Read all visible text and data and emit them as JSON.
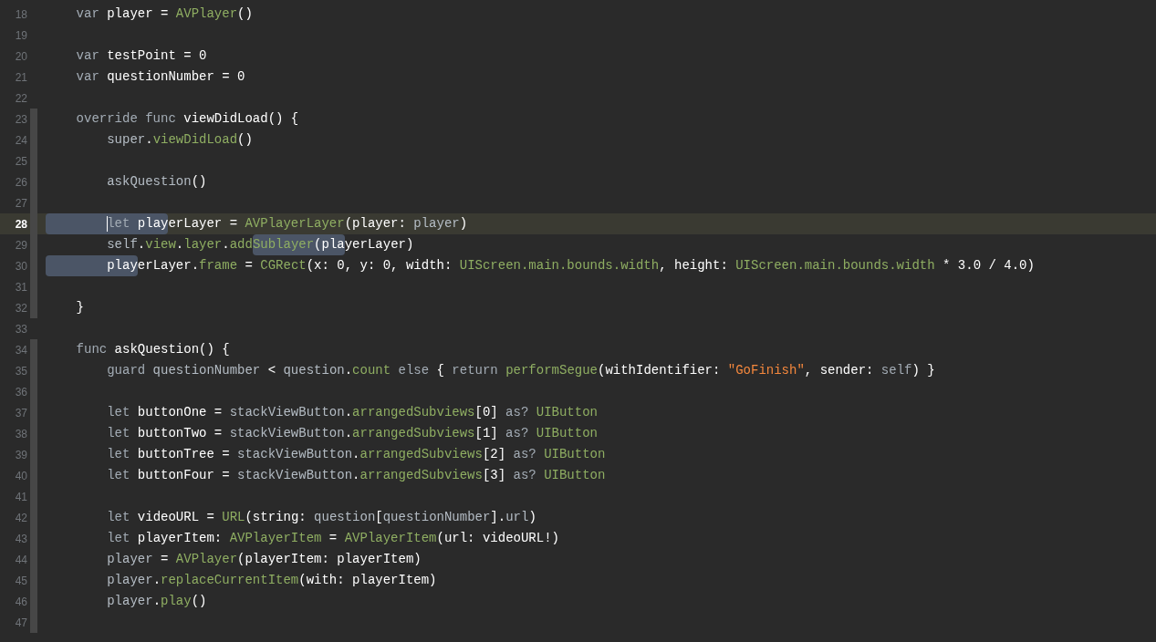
{
  "editor": {
    "lines": [
      {
        "number": "18",
        "current": false,
        "scope": false,
        "tokens": [
          {
            "text": "    var",
            "kind": "keyword"
          },
          {
            "text": " player = ",
            "kind": "plain"
          },
          {
            "text": "AVPlayer",
            "kind": "api"
          },
          {
            "text": "()",
            "kind": "plain"
          }
        ]
      },
      {
        "number": "19",
        "current": false,
        "scope": false
      },
      {
        "number": "20",
        "current": false,
        "scope": false,
        "tokens": [
          {
            "text": "    var",
            "kind": "keyword"
          },
          {
            "text": " testPoint = 0",
            "kind": "plain"
          }
        ]
      },
      {
        "number": "21",
        "current": false,
        "scope": false,
        "tokens": [
          {
            "text": "    var",
            "kind": "keyword"
          },
          {
            "text": " questionNumber = 0",
            "kind": "plain"
          }
        ]
      },
      {
        "number": "22",
        "current": false,
        "scope": false
      },
      {
        "number": "23",
        "current": false,
        "scope": true,
        "tokens": [
          {
            "text": "    override func",
            "kind": "keyword"
          },
          {
            "text": " viewDidLoad() {",
            "kind": "plain"
          }
        ]
      },
      {
        "number": "24",
        "current": false,
        "scope": true,
        "tokens": [
          {
            "text": "        super",
            "kind": "reference"
          },
          {
            "text": ".",
            "kind": "plain"
          },
          {
            "text": "viewDidLoad",
            "kind": "api"
          },
          {
            "text": "()",
            "kind": "plain"
          }
        ]
      },
      {
        "number": "25",
        "current": false,
        "scope": true
      },
      {
        "number": "26",
        "current": false,
        "scope": true,
        "tokens": [
          {
            "text": "        askQuestion",
            "kind": "reference"
          },
          {
            "text": "()",
            "kind": "plain"
          }
        ]
      },
      {
        "number": "27",
        "current": false,
        "scope": true
      },
      {
        "number": "28",
        "current": true,
        "scope": true,
        "tokens": [
          {
            "text": "        let",
            "kind": "keyword",
            "highlighted": true,
            "caret": true
          },
          {
            "text": " play",
            "kind": "plain",
            "highlighted": true
          },
          {
            "text": "erLayer = ",
            "kind": "plain"
          },
          {
            "text": "AVPlayerLayer",
            "kind": "api"
          },
          {
            "text": "(player: ",
            "kind": "plain"
          },
          {
            "text": "player",
            "kind": "reference"
          },
          {
            "text": ")",
            "kind": "plain"
          }
        ]
      },
      {
        "number": "29",
        "current": false,
        "scope": true,
        "tokens": [
          {
            "text": "        self",
            "kind": "reference"
          },
          {
            "text": ".",
            "kind": "plain"
          },
          {
            "text": "view",
            "kind": "api"
          },
          {
            "text": ".",
            "kind": "plain"
          },
          {
            "text": "layer",
            "kind": "api"
          },
          {
            "text": ".",
            "kind": "plain"
          },
          {
            "text": "add",
            "kind": "api"
          },
          {
            "text": "Sublayer",
            "kind": "api",
            "highlighted": true
          },
          {
            "text": "(pla",
            "kind": "plain",
            "highlighted": true
          },
          {
            "text": "yerLayer)",
            "kind": "plain"
          }
        ]
      },
      {
        "number": "30",
        "current": false,
        "scope": true,
        "tokens": [
          {
            "text": "        play",
            "kind": "plain",
            "highlighted": true
          },
          {
            "text": "erLayer.",
            "kind": "plain"
          },
          {
            "text": "frame",
            "kind": "api"
          },
          {
            "text": " = ",
            "kind": "plain"
          },
          {
            "text": "CGRect",
            "kind": "api"
          },
          {
            "text": "(x: 0, y: 0, width: ",
            "kind": "plain"
          },
          {
            "text": "UIScreen.main.bounds.width",
            "kind": "api"
          },
          {
            "text": ", height: ",
            "kind": "plain"
          },
          {
            "text": "UIScreen.main.bounds.width",
            "kind": "api"
          },
          {
            "text": " * 3.0 / 4.0)",
            "kind": "plain"
          }
        ]
      },
      {
        "number": "31",
        "current": false,
        "scope": true
      },
      {
        "number": "32",
        "current": false,
        "scope": true,
        "tokens": [
          {
            "text": "    }",
            "kind": "plain"
          }
        ]
      },
      {
        "number": "33",
        "current": false,
        "scope": false
      },
      {
        "number": "34",
        "current": false,
        "scope": true,
        "tokens": [
          {
            "text": "    func",
            "kind": "keyword"
          },
          {
            "text": " askQuestion() {",
            "kind": "plain"
          }
        ]
      },
      {
        "number": "35",
        "current": false,
        "scope": true,
        "tokens": [
          {
            "text": "        guard",
            "kind": "keyword"
          },
          {
            "text": " questionNumber",
            "kind": "reference"
          },
          {
            "text": " < ",
            "kind": "plain"
          },
          {
            "text": "question",
            "kind": "reference"
          },
          {
            "text": ".",
            "kind": "plain"
          },
          {
            "text": "count",
            "kind": "api"
          },
          {
            "text": " else",
            "kind": "keyword"
          },
          {
            "text": " { ",
            "kind": "plain"
          },
          {
            "text": "return",
            "kind": "keyword"
          },
          {
            "text": " performSegue",
            "kind": "api"
          },
          {
            "text": "(withIdentifier: ",
            "kind": "plain"
          },
          {
            "text": "\"GoFinish\"",
            "kind": "string"
          },
          {
            "text": ", sender: ",
            "kind": "plain"
          },
          {
            "text": "self",
            "kind": "keyword"
          },
          {
            "text": ") }",
            "kind": "plain"
          }
        ]
      },
      {
        "number": "36",
        "current": false,
        "scope": true
      },
      {
        "number": "37",
        "current": false,
        "scope": true,
        "tokens": [
          {
            "text": "        let",
            "kind": "keyword"
          },
          {
            "text": " buttonOne = ",
            "kind": "plain"
          },
          {
            "text": "stackViewButton",
            "kind": "reference"
          },
          {
            "text": ".",
            "kind": "plain"
          },
          {
            "text": "arrangedSubviews",
            "kind": "api"
          },
          {
            "text": "[0] ",
            "kind": "plain"
          },
          {
            "text": "as?",
            "kind": "keyword"
          },
          {
            "text": " UIButton",
            "kind": "api"
          }
        ]
      },
      {
        "number": "38",
        "current": false,
        "scope": true,
        "tokens": [
          {
            "text": "        let",
            "kind": "keyword"
          },
          {
            "text": " buttonTwo = ",
            "kind": "plain"
          },
          {
            "text": "stackViewButton",
            "kind": "reference"
          },
          {
            "text": ".",
            "kind": "plain"
          },
          {
            "text": "arrangedSubviews",
            "kind": "api"
          },
          {
            "text": "[1] ",
            "kind": "plain"
          },
          {
            "text": "as?",
            "kind": "keyword"
          },
          {
            "text": " UIButton",
            "kind": "api"
          }
        ]
      },
      {
        "number": "39",
        "current": false,
        "scope": true,
        "tokens": [
          {
            "text": "        let",
            "kind": "keyword"
          },
          {
            "text": " buttonTree = ",
            "kind": "plain"
          },
          {
            "text": "stackViewButton",
            "kind": "reference"
          },
          {
            "text": ".",
            "kind": "plain"
          },
          {
            "text": "arrangedSubviews",
            "kind": "api"
          },
          {
            "text": "[2] ",
            "kind": "plain"
          },
          {
            "text": "as?",
            "kind": "keyword"
          },
          {
            "text": " UIButton",
            "kind": "api"
          }
        ]
      },
      {
        "number": "40",
        "current": false,
        "scope": true,
        "tokens": [
          {
            "text": "        let",
            "kind": "keyword"
          },
          {
            "text": " buttonFour = ",
            "kind": "plain"
          },
          {
            "text": "stackViewButton",
            "kind": "reference"
          },
          {
            "text": ".",
            "kind": "plain"
          },
          {
            "text": "arrangedSubviews",
            "kind": "api"
          },
          {
            "text": "[3] ",
            "kind": "plain"
          },
          {
            "text": "as?",
            "kind": "keyword"
          },
          {
            "text": " UIButton",
            "kind": "api"
          }
        ]
      },
      {
        "number": "41",
        "current": false,
        "scope": true
      },
      {
        "number": "42",
        "current": false,
        "scope": true,
        "tokens": [
          {
            "text": "        let",
            "kind": "keyword"
          },
          {
            "text": " videoURL = ",
            "kind": "plain"
          },
          {
            "text": "URL",
            "kind": "api"
          },
          {
            "text": "(string: ",
            "kind": "plain"
          },
          {
            "text": "question",
            "kind": "reference"
          },
          {
            "text": "[",
            "kind": "plain"
          },
          {
            "text": "questionNumber",
            "kind": "reference"
          },
          {
            "text": "].",
            "kind": "plain"
          },
          {
            "text": "url",
            "kind": "reference"
          },
          {
            "text": ")",
            "kind": "plain"
          }
        ]
      },
      {
        "number": "43",
        "current": false,
        "scope": true,
        "tokens": [
          {
            "text": "        let",
            "kind": "keyword"
          },
          {
            "text": " playerItem: ",
            "kind": "plain"
          },
          {
            "text": "AVPlayerItem",
            "kind": "api"
          },
          {
            "text": " = ",
            "kind": "plain"
          },
          {
            "text": "AVPlayerItem",
            "kind": "api"
          },
          {
            "text": "(url: videoURL!)",
            "kind": "plain"
          }
        ]
      },
      {
        "number": "44",
        "current": false,
        "scope": true,
        "tokens": [
          {
            "text": "        player",
            "kind": "reference"
          },
          {
            "text": " = ",
            "kind": "plain"
          },
          {
            "text": "AVPlayer",
            "kind": "api"
          },
          {
            "text": "(playerItem: playerItem)",
            "kind": "plain"
          }
        ]
      },
      {
        "number": "45",
        "current": false,
        "scope": true,
        "tokens": [
          {
            "text": "        player",
            "kind": "reference"
          },
          {
            "text": ".",
            "kind": "plain"
          },
          {
            "text": "replaceCurrentItem",
            "kind": "api"
          },
          {
            "text": "(with: playerItem)",
            "kind": "plain"
          }
        ]
      },
      {
        "number": "46",
        "current": false,
        "scope": true,
        "tokens": [
          {
            "text": "        player",
            "kind": "reference"
          },
          {
            "text": ".",
            "kind": "plain"
          },
          {
            "text": "play",
            "kind": "api"
          },
          {
            "text": "()",
            "kind": "plain"
          }
        ]
      },
      {
        "number": "47",
        "current": false,
        "scope": true
      }
    ]
  }
}
